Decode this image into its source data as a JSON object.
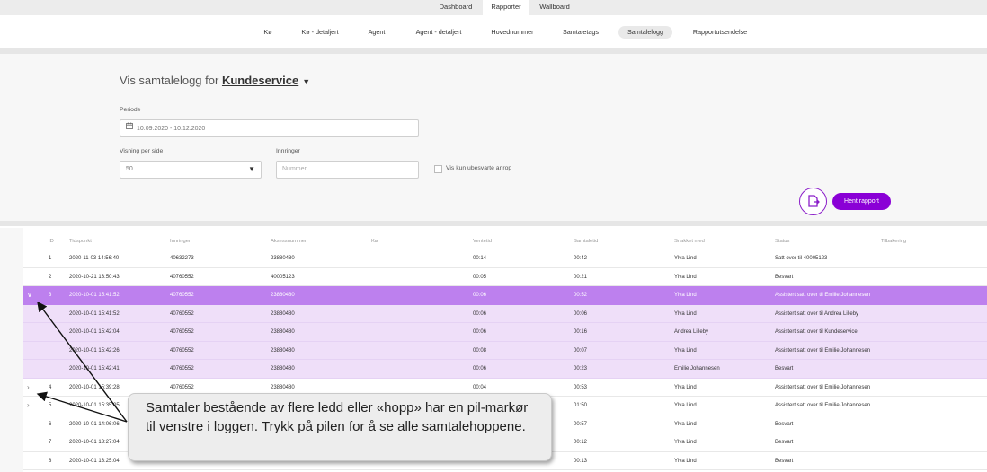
{
  "top_nav": [
    "Dashboard",
    "Rapporter",
    "Wallboard"
  ],
  "active_top_tab": "Rapporter",
  "sub_nav": [
    "Kø",
    "Kø - detaljert",
    "Agent",
    "Agent - detaljert",
    "Hovednummer",
    "Samtaletags",
    "Samtalelogg",
    "Rapportutsendelse"
  ],
  "active_sub_tab": "Samtalelogg",
  "heading": {
    "prefix": "Vis samtalelogg for",
    "department": "Kundeservice",
    "caret": "▼"
  },
  "filters": {
    "period_label": "Periode",
    "period_value": "10.09.2020 - 10.12.2020",
    "per_page_label": "Visning per side",
    "per_page_value": "50",
    "caller_label": "Innringer",
    "caller_placeholder": "Nummer",
    "unanswered_label": "Vis kun ubesvarte anrop",
    "unanswered_checked": false,
    "fetch_button": "Hent rapport"
  },
  "table": {
    "columns": [
      "ID",
      "Tidspunkt",
      "Innringer",
      "Aksessnummer",
      "Kø",
      "Ventetid",
      "Samtaletid",
      "Snakket med",
      "Status",
      "Tilbakering"
    ],
    "rows": [
      {
        "type": "normal",
        "chevron": "",
        "id": "1",
        "time": "2020-11-03 14:56:40",
        "caller": "40632273",
        "access": "23880480",
        "queue": "",
        "wait": "00:14",
        "talk": "00:42",
        "with": "Ylva Lind",
        "status": "Satt over til 40005123",
        "callback": ""
      },
      {
        "type": "normal",
        "chevron": "",
        "id": "2",
        "time": "2020-10-21 13:50:43",
        "caller": "40760552",
        "access": "40005123",
        "queue": "",
        "wait": "00:05",
        "talk": "00:21",
        "with": "Ylva Lind",
        "status": "Besvart",
        "callback": ""
      },
      {
        "type": "sel",
        "chevron": "∨",
        "id": "3",
        "time": "2020-10-01 15:41:52",
        "caller": "40760552",
        "access": "23880480",
        "queue": "",
        "wait": "00:06",
        "talk": "00:52",
        "with": "Ylva Lind",
        "status": "Assistert satt over til Emilie Johannesen",
        "callback": ""
      },
      {
        "type": "sub",
        "chevron": "",
        "id": "",
        "time": "2020-10-01 15:41:52",
        "caller": "40760552",
        "access": "23880480",
        "queue": "",
        "wait": "00:06",
        "talk": "00:06",
        "with": "Ylva Lind",
        "status": "Assistert satt over til Andrea Lilleby",
        "callback": ""
      },
      {
        "type": "sub",
        "chevron": "",
        "id": "",
        "time": "2020-10-01 15:42:04",
        "caller": "40760552",
        "access": "23880480",
        "queue": "",
        "wait": "00:06",
        "talk": "00:16",
        "with": "Andrea Lilleby",
        "status": "Assistert satt over til Kundeservice",
        "callback": ""
      },
      {
        "type": "sub",
        "chevron": "",
        "id": "",
        "time": "2020-10-01 15:42:26",
        "caller": "40760552",
        "access": "23880480",
        "queue": "",
        "wait": "00:08",
        "talk": "00:07",
        "with": "Ylva Lind",
        "status": "Assistert satt over til Emilie Johannesen",
        "callback": ""
      },
      {
        "type": "sub",
        "chevron": "",
        "id": "",
        "time": "2020-10-01 15:42:41",
        "caller": "40760552",
        "access": "23880480",
        "queue": "",
        "wait": "00:06",
        "talk": "00:23",
        "with": "Emilie Johannesen",
        "status": "Besvart",
        "callback": ""
      },
      {
        "type": "normal",
        "chevron": "›",
        "id": "4",
        "time": "2020-10-01 15:39:28",
        "caller": "40760552",
        "access": "23880480",
        "queue": "",
        "wait": "00:04",
        "talk": "00:53",
        "with": "Ylva Lind",
        "status": "Assistert satt over til Emilie Johannesen",
        "callback": ""
      },
      {
        "type": "normal",
        "chevron": "›",
        "id": "5",
        "time": "2020-10-01 15:35:05",
        "caller": "",
        "access": "",
        "queue": "",
        "wait": "",
        "talk": "01:50",
        "with": "Ylva Lind",
        "status": "Assistert satt over til Emilie Johannesen",
        "callback": ""
      },
      {
        "type": "normal",
        "chevron": "",
        "id": "6",
        "time": "2020-10-01 14:06:06",
        "caller": "",
        "access": "",
        "queue": "",
        "wait": "",
        "talk": "00:57",
        "with": "Ylva Lind",
        "status": "Besvart",
        "callback": ""
      },
      {
        "type": "normal",
        "chevron": "",
        "id": "7",
        "time": "2020-10-01 13:27:04",
        "caller": "",
        "access": "",
        "queue": "",
        "wait": "",
        "talk": "00:12",
        "with": "Ylva Lind",
        "status": "Besvart",
        "callback": ""
      },
      {
        "type": "normal",
        "chevron": "",
        "id": "8",
        "time": "2020-10-01 13:25:04",
        "caller": "",
        "access": "",
        "queue": "",
        "wait": "",
        "talk": "00:13",
        "with": "Ylva Lind",
        "status": "Besvart",
        "callback": ""
      }
    ]
  },
  "callout": {
    "text": "Samtaler bestående av flere ledd eller «hopp» har en pil-markør til venstre i loggen. Trykk på pilen for å se alle samtalehoppene."
  },
  "colors": {
    "accent": "#8a00d6",
    "selected_row": "#bd80ee",
    "sub_row": "#efdff9"
  }
}
